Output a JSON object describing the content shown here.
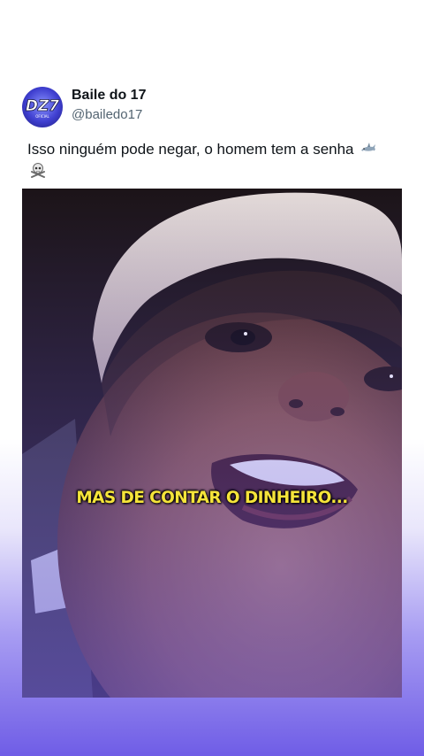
{
  "account": {
    "name": "Baile do 17",
    "handle": "@bailedo17",
    "avatar_text": "DZ7",
    "avatar_subtext": "OFICIAL"
  },
  "tweet": {
    "text": "Isso ninguém pode negar, o homem tem a senha",
    "emojis": [
      "shark-icon",
      "skull-crossbones-icon"
    ]
  },
  "media": {
    "caption": "MAS DE CONTAR O DINHEIRO..."
  },
  "colors": {
    "caption": "#f5e43a",
    "name": "#0f1419",
    "handle": "#536471",
    "gradient_bottom": "#6f5de6"
  }
}
